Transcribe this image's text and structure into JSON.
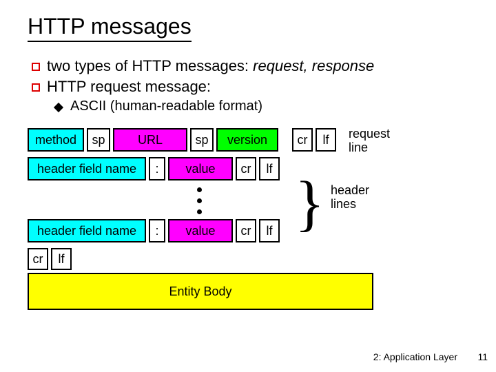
{
  "title": "HTTP messages",
  "bullet1_pre": "two types of HTTP messages: ",
  "bullet1_em": "request, response",
  "bullet2": "HTTP request message:",
  "sub1": "ASCII (human-readable format)",
  "row1": {
    "method": "method",
    "sp1": "sp",
    "url": "URL",
    "sp2": "sp",
    "version": "version",
    "cr": "cr",
    "lf": "lf"
  },
  "row2": {
    "hfn": "header field name",
    "colon": ":",
    "value": "value",
    "cr": "cr",
    "lf": "lf"
  },
  "row3": {
    "hfn": "header field name",
    "colon": ":",
    "value": "value",
    "cr": "cr",
    "lf": "lf"
  },
  "row4": {
    "cr": "cr",
    "lf": "lf"
  },
  "entity": "Entity Body",
  "label_request_line1": "request",
  "label_request_line2": "line",
  "label_header1": "header",
  "label_header2": "lines",
  "footer": "2: Application Layer",
  "page": "11",
  "chart_data": {
    "type": "table",
    "title": "HTTP request message format",
    "rows": [
      [
        "method",
        "sp",
        "URL",
        "sp",
        "version",
        "cr",
        "lf"
      ],
      [
        "header field name",
        ":",
        "value",
        "cr",
        "lf"
      ],
      [
        "...repeated..."
      ],
      [
        "header field name",
        ":",
        "value",
        "cr",
        "lf"
      ],
      [
        "cr",
        "lf"
      ],
      [
        "Entity Body"
      ]
    ],
    "annotations": [
      "request line",
      "header lines"
    ]
  }
}
